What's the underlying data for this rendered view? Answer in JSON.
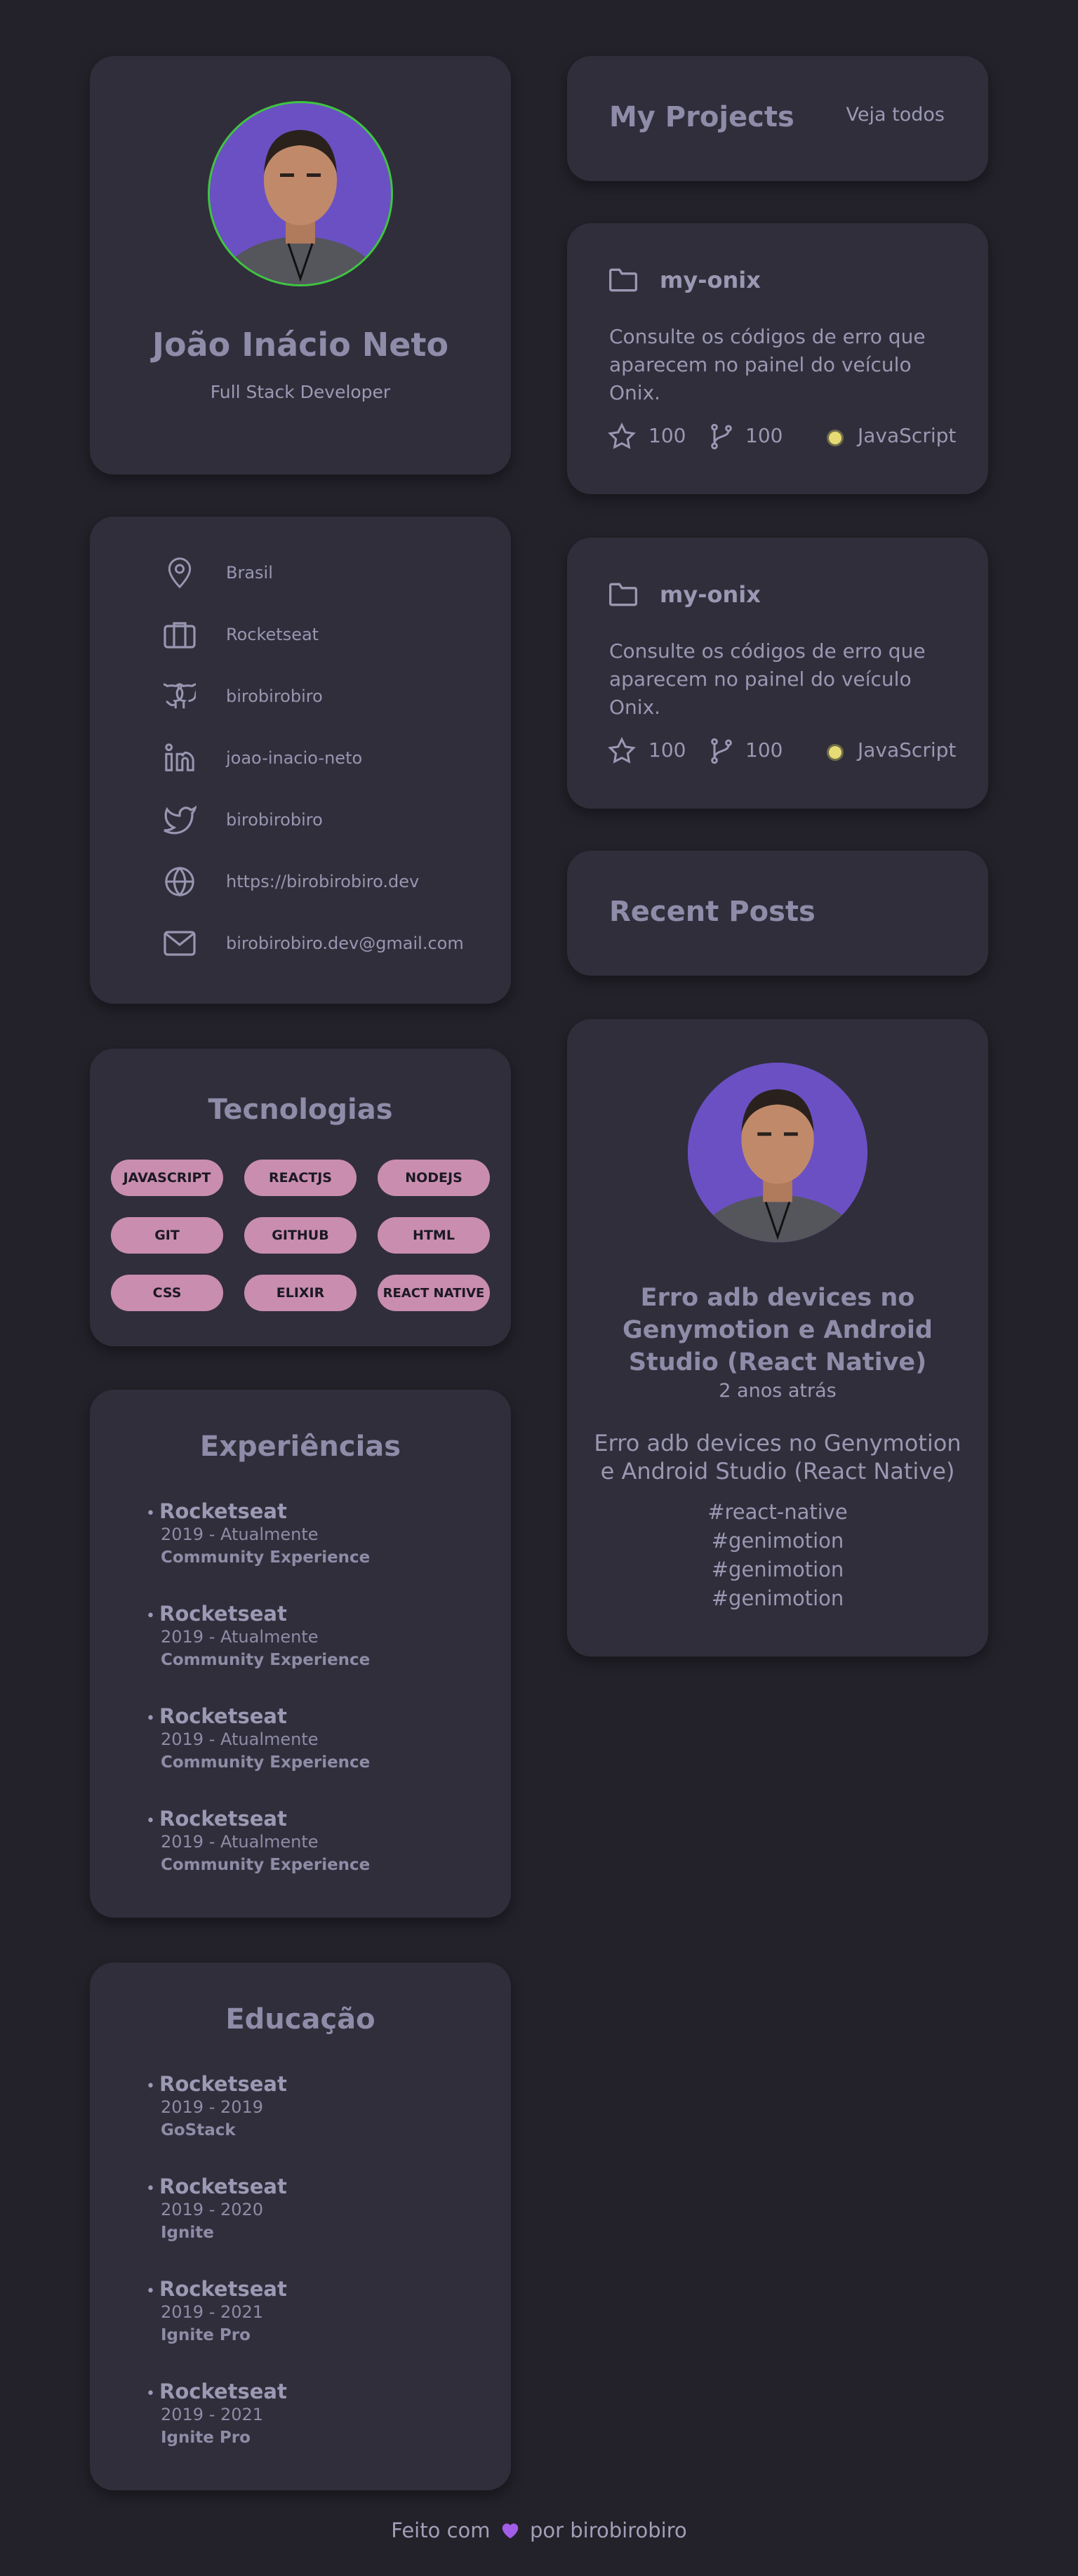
{
  "profile": {
    "name": "João Inácio Neto",
    "role": "Full Stack Developer"
  },
  "links": [
    {
      "icon": "map-pin-icon",
      "label": "Brasil"
    },
    {
      "icon": "briefcase-icon",
      "label": "Rocketseat"
    },
    {
      "icon": "github-icon",
      "label": "birobirobiro"
    },
    {
      "icon": "linkedin-icon",
      "label": "joao-inacio-neto"
    },
    {
      "icon": "twitter-icon",
      "label": "birobirobiro"
    },
    {
      "icon": "globe-icon",
      "label": "https://birobirobiro.dev"
    },
    {
      "icon": "mail-icon",
      "label": "birobirobiro.dev@gmail.com"
    }
  ],
  "technologies": {
    "title": "Tecnologias",
    "items": [
      "JAVASCRIPT",
      "REACTJS",
      "NODEJS",
      "GIT",
      "GITHUB",
      "HTML",
      "CSS",
      "ELIXIR",
      "REACT NATIVE"
    ]
  },
  "experiences": {
    "title": "Experiências",
    "items": [
      {
        "company": "Rocketseat",
        "period": "2019 - Atualmente",
        "role": "Community Experience"
      },
      {
        "company": "Rocketseat",
        "period": "2019 - Atualmente",
        "role": "Community Experience"
      },
      {
        "company": "Rocketseat",
        "period": "2019 - Atualmente",
        "role": "Community Experience"
      },
      {
        "company": "Rocketseat",
        "period": "2019 - Atualmente",
        "role": "Community Experience"
      }
    ]
  },
  "education": {
    "title": "Educação",
    "items": [
      {
        "school": "Rocketseat",
        "period": "2019 - 2019",
        "course": "GoStack"
      },
      {
        "school": "Rocketseat",
        "period": "2019 - 2020",
        "course": "Ignite"
      },
      {
        "school": "Rocketseat",
        "period": "2019 - 2021",
        "course": "Ignite Pro"
      },
      {
        "school": "Rocketseat",
        "period": "2019 - 2021",
        "course": "Ignite Pro"
      }
    ]
  },
  "projects": {
    "title": "My Projects",
    "see_all": "Veja todos",
    "items": [
      {
        "name": "my-onix",
        "description": "Consulte os códigos de erro que aparecem no painel do veículo Onix.",
        "stars": "100",
        "forks": "100",
        "language": "JavaScript",
        "language_color": "#e6db74"
      },
      {
        "name": "my-onix",
        "description": "Consulte os códigos de erro que aparecem no painel do veículo Onix.",
        "stars": "100",
        "forks": "100",
        "language": "JavaScript",
        "language_color": "#e6db74"
      }
    ]
  },
  "posts": {
    "title": "Recent Posts",
    "items": [
      {
        "title": "Erro adb devices no Genymotion e Android Studio (React Native)",
        "time_ago": "2 anos atrás",
        "summary": "Erro adb devices no Genymotion e Android Studio (React Native)",
        "tags": [
          "#react-native",
          "#genimotion",
          "#genimotion",
          "#genimotion"
        ]
      }
    ]
  },
  "footer": {
    "prefix": "Feito com",
    "heart_icon": "purple-heart-icon",
    "suffix": "por birobirobiro"
  },
  "colors": {
    "background": "#232129",
    "card": "#302e3b",
    "pill": "#c98db0",
    "avatar_ring": "#3ec63e",
    "avatar_bg": "#6b50c4"
  }
}
